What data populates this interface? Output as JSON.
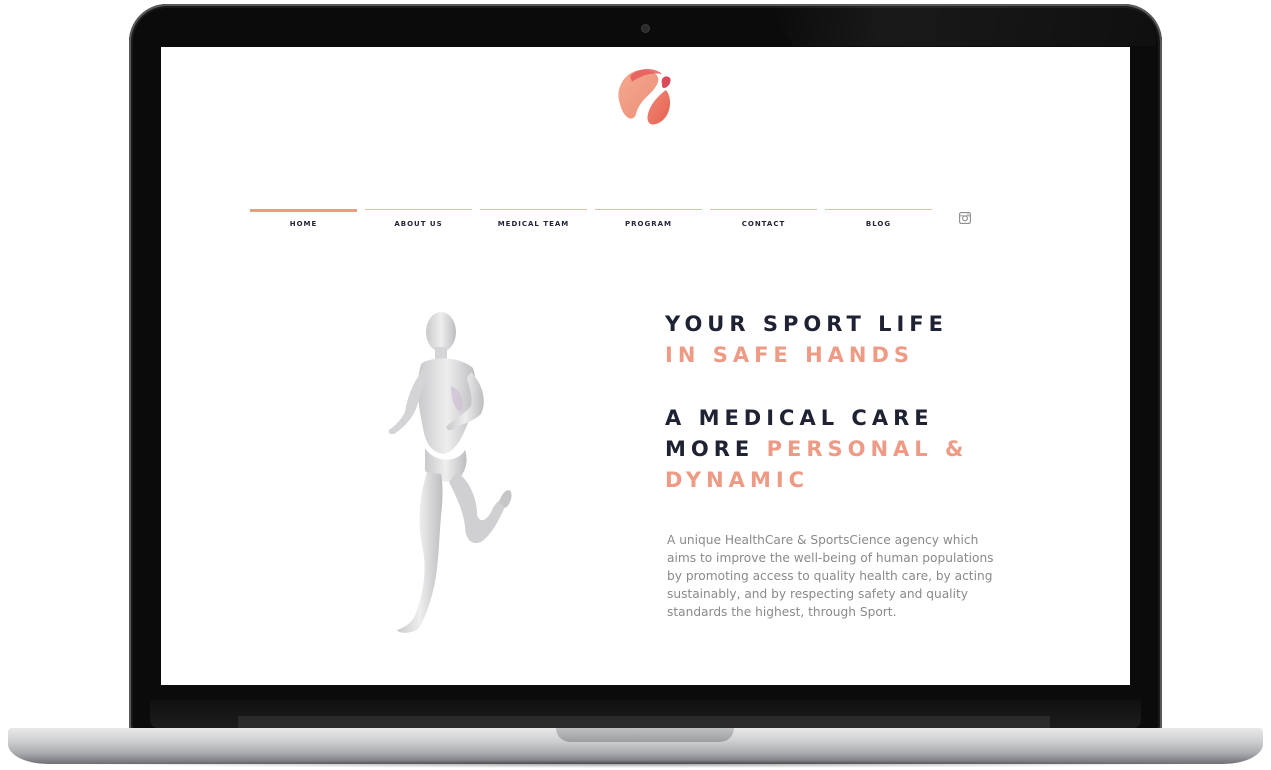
{
  "colors": {
    "accent": "#ee9b86",
    "accent_dark": "#e46a5f",
    "heading_dark": "#1f2233",
    "body_text": "#8a8a8d"
  },
  "nav": {
    "items": [
      {
        "label": "HOME",
        "active": true
      },
      {
        "label": "ABOUT US",
        "active": false
      },
      {
        "label": "MEDICAL TEAM",
        "active": false
      },
      {
        "label": "PROGRAM",
        "active": false
      },
      {
        "label": "CONTACT",
        "active": false
      },
      {
        "label": "BLOG",
        "active": false
      }
    ],
    "social_icon": "instagram-icon"
  },
  "hero": {
    "line1": "YOUR SPORT LIFE",
    "line2": "IN SAFE HANDS",
    "line3": "A MEDICAL CARE",
    "line4_dark": "MORE ",
    "line4_accent": "PERSONAL &",
    "line5": "DYNAMIC",
    "description": "A unique HealthCare & SportsCience agency which aims to improve the well-being of human populations by promoting access to quality health care, by acting sustainably, and by respecting safety and quality standards the highest, through Sport."
  },
  "images": {
    "logo": "brand-logo",
    "hero_figure": "running-mannequin-figure"
  }
}
